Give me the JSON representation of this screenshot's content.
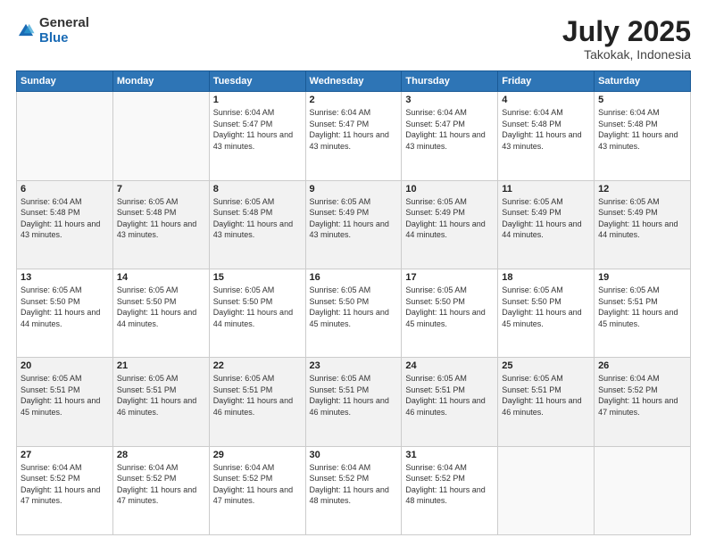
{
  "logo": {
    "general": "General",
    "blue": "Blue"
  },
  "title": {
    "month": "July 2025",
    "location": "Takokak, Indonesia"
  },
  "weekdays": [
    "Sunday",
    "Monday",
    "Tuesday",
    "Wednesday",
    "Thursday",
    "Friday",
    "Saturday"
  ],
  "rows": [
    [
      {
        "day": "",
        "info": ""
      },
      {
        "day": "",
        "info": ""
      },
      {
        "day": "1",
        "info": "Sunrise: 6:04 AM\nSunset: 5:47 PM\nDaylight: 11 hours and 43 minutes."
      },
      {
        "day": "2",
        "info": "Sunrise: 6:04 AM\nSunset: 5:47 PM\nDaylight: 11 hours and 43 minutes."
      },
      {
        "day": "3",
        "info": "Sunrise: 6:04 AM\nSunset: 5:47 PM\nDaylight: 11 hours and 43 minutes."
      },
      {
        "day": "4",
        "info": "Sunrise: 6:04 AM\nSunset: 5:48 PM\nDaylight: 11 hours and 43 minutes."
      },
      {
        "day": "5",
        "info": "Sunrise: 6:04 AM\nSunset: 5:48 PM\nDaylight: 11 hours and 43 minutes."
      }
    ],
    [
      {
        "day": "6",
        "info": "Sunrise: 6:04 AM\nSunset: 5:48 PM\nDaylight: 11 hours and 43 minutes."
      },
      {
        "day": "7",
        "info": "Sunrise: 6:05 AM\nSunset: 5:48 PM\nDaylight: 11 hours and 43 minutes."
      },
      {
        "day": "8",
        "info": "Sunrise: 6:05 AM\nSunset: 5:48 PM\nDaylight: 11 hours and 43 minutes."
      },
      {
        "day": "9",
        "info": "Sunrise: 6:05 AM\nSunset: 5:49 PM\nDaylight: 11 hours and 43 minutes."
      },
      {
        "day": "10",
        "info": "Sunrise: 6:05 AM\nSunset: 5:49 PM\nDaylight: 11 hours and 44 minutes."
      },
      {
        "day": "11",
        "info": "Sunrise: 6:05 AM\nSunset: 5:49 PM\nDaylight: 11 hours and 44 minutes."
      },
      {
        "day": "12",
        "info": "Sunrise: 6:05 AM\nSunset: 5:49 PM\nDaylight: 11 hours and 44 minutes."
      }
    ],
    [
      {
        "day": "13",
        "info": "Sunrise: 6:05 AM\nSunset: 5:50 PM\nDaylight: 11 hours and 44 minutes."
      },
      {
        "day": "14",
        "info": "Sunrise: 6:05 AM\nSunset: 5:50 PM\nDaylight: 11 hours and 44 minutes."
      },
      {
        "day": "15",
        "info": "Sunrise: 6:05 AM\nSunset: 5:50 PM\nDaylight: 11 hours and 44 minutes."
      },
      {
        "day": "16",
        "info": "Sunrise: 6:05 AM\nSunset: 5:50 PM\nDaylight: 11 hours and 45 minutes."
      },
      {
        "day": "17",
        "info": "Sunrise: 6:05 AM\nSunset: 5:50 PM\nDaylight: 11 hours and 45 minutes."
      },
      {
        "day": "18",
        "info": "Sunrise: 6:05 AM\nSunset: 5:50 PM\nDaylight: 11 hours and 45 minutes."
      },
      {
        "day": "19",
        "info": "Sunrise: 6:05 AM\nSunset: 5:51 PM\nDaylight: 11 hours and 45 minutes."
      }
    ],
    [
      {
        "day": "20",
        "info": "Sunrise: 6:05 AM\nSunset: 5:51 PM\nDaylight: 11 hours and 45 minutes."
      },
      {
        "day": "21",
        "info": "Sunrise: 6:05 AM\nSunset: 5:51 PM\nDaylight: 11 hours and 46 minutes."
      },
      {
        "day": "22",
        "info": "Sunrise: 6:05 AM\nSunset: 5:51 PM\nDaylight: 11 hours and 46 minutes."
      },
      {
        "day": "23",
        "info": "Sunrise: 6:05 AM\nSunset: 5:51 PM\nDaylight: 11 hours and 46 minutes."
      },
      {
        "day": "24",
        "info": "Sunrise: 6:05 AM\nSunset: 5:51 PM\nDaylight: 11 hours and 46 minutes."
      },
      {
        "day": "25",
        "info": "Sunrise: 6:05 AM\nSunset: 5:51 PM\nDaylight: 11 hours and 46 minutes."
      },
      {
        "day": "26",
        "info": "Sunrise: 6:04 AM\nSunset: 5:52 PM\nDaylight: 11 hours and 47 minutes."
      }
    ],
    [
      {
        "day": "27",
        "info": "Sunrise: 6:04 AM\nSunset: 5:52 PM\nDaylight: 11 hours and 47 minutes."
      },
      {
        "day": "28",
        "info": "Sunrise: 6:04 AM\nSunset: 5:52 PM\nDaylight: 11 hours and 47 minutes."
      },
      {
        "day": "29",
        "info": "Sunrise: 6:04 AM\nSunset: 5:52 PM\nDaylight: 11 hours and 47 minutes."
      },
      {
        "day": "30",
        "info": "Sunrise: 6:04 AM\nSunset: 5:52 PM\nDaylight: 11 hours and 48 minutes."
      },
      {
        "day": "31",
        "info": "Sunrise: 6:04 AM\nSunset: 5:52 PM\nDaylight: 11 hours and 48 minutes."
      },
      {
        "day": "",
        "info": ""
      },
      {
        "day": "",
        "info": ""
      }
    ]
  ]
}
